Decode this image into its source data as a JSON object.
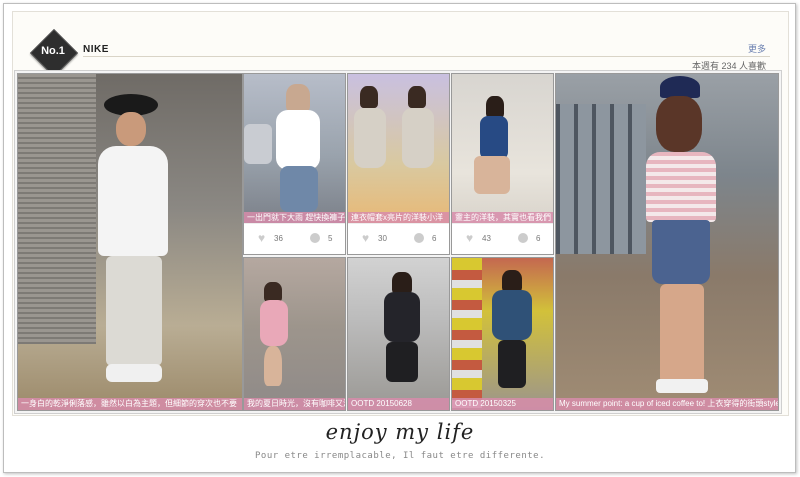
{
  "rank": {
    "label": "No.1"
  },
  "brand": {
    "name": "NIKE"
  },
  "header": {
    "more_link": "更多",
    "likes_text": "本週有 234 人喜歡"
  },
  "posts": [
    {
      "caption": "一身白的乾淨俐落感，雖然以白為主題，但細節的穿次也不要"
    },
    {
      "caption": "一出門就下大雨 趕快換褲子",
      "likes": "36",
      "comments": "5"
    },
    {
      "caption": "連衣帽套x亮片的洋裝小洋",
      "likes": "30",
      "comments": "6"
    },
    {
      "caption": "靈主的洋裝，其實也看我們",
      "likes": "43",
      "comments": "6"
    },
    {
      "caption": "我的夏日時光，沒有咖啡又沒有色彩"
    },
    {
      "caption": "OOTD 20150628"
    },
    {
      "caption": "OOTD 20150325"
    },
    {
      "caption": "My summer point: a cup of iced coffee to! 上衣穿得的街頭style!"
    }
  ],
  "footer": {
    "title": "enjoy my life",
    "subtitle": "Pour etre irremplacable, Il faut etre differente."
  },
  "colors": {
    "caption_bg": "#d78caa",
    "link": "#6a7fb0",
    "rank_badge": "#2e2e2e"
  }
}
